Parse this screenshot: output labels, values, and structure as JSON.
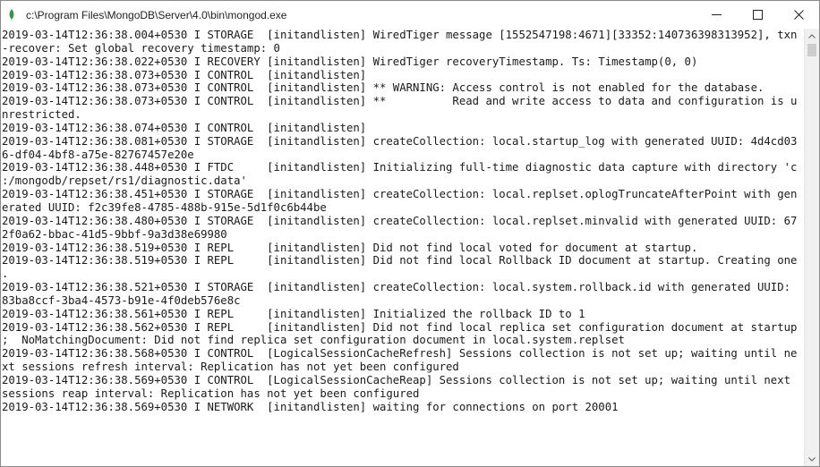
{
  "window": {
    "title": "c:\\Program Files\\MongoDB\\Server\\4.0\\bin\\mongod.exe",
    "accent_color": "#2e9e45",
    "icons": {
      "app": "mongodb-leaf-icon",
      "minimize": "minimize-icon",
      "maximize": "maximize-icon",
      "close": "close-icon",
      "scroll_up": "chevron-up-icon",
      "scroll_down": "chevron-down-icon"
    }
  },
  "console": {
    "lines": [
      "2019-03-14T12:36:38.004+0530 I STORAGE  [initandlisten] WiredTiger message [1552547198:4671][33352:140736398313952], txn",
      "-recover: Set global recovery timestamp: 0",
      "2019-03-14T12:36:38.022+0530 I RECOVERY [initandlisten] WiredTiger recoveryTimestamp. Ts: Timestamp(0, 0)",
      "2019-03-14T12:36:38.073+0530 I CONTROL  [initandlisten]",
      "2019-03-14T12:36:38.073+0530 I CONTROL  [initandlisten] ** WARNING: Access control is not enabled for the database.",
      "2019-03-14T12:36:38.073+0530 I CONTROL  [initandlisten] **          Read and write access to data and configuration is u",
      "nrestricted.",
      "2019-03-14T12:36:38.074+0530 I CONTROL  [initandlisten]",
      "2019-03-14T12:36:38.081+0530 I STORAGE  [initandlisten] createCollection: local.startup_log with generated UUID: 4d4cd03",
      "6-df04-4bf8-a75e-82767457e20e",
      "2019-03-14T12:36:38.448+0530 I FTDC     [initandlisten] Initializing full-time diagnostic data capture with directory 'c",
      ":/mongodb/repset/rs1/diagnostic.data'",
      "2019-03-14T12:36:38.451+0530 I STORAGE  [initandlisten] createCollection: local.replset.oplogTruncateAfterPoint with gen",
      "erated UUID: f2c39fe8-4785-488b-915e-5d1f0c6b44be",
      "2019-03-14T12:36:38.480+0530 I STORAGE  [initandlisten] createCollection: local.replset.minvalid with generated UUID: 67",
      "2f0a62-bbac-41d5-9bbf-9a3d38e69980",
      "2019-03-14T12:36:38.519+0530 I REPL     [initandlisten] Did not find local voted for document at startup.",
      "2019-03-14T12:36:38.519+0530 I REPL     [initandlisten] Did not find local Rollback ID document at startup. Creating one",
      ".",
      "2019-03-14T12:36:38.521+0530 I STORAGE  [initandlisten] createCollection: local.system.rollback.id with generated UUID:",
      "83ba8ccf-3ba4-4573-b91e-4f0deb576e8c",
      "2019-03-14T12:36:38.561+0530 I REPL     [initandlisten] Initialized the rollback ID to 1",
      "2019-03-14T12:36:38.562+0530 I REPL     [initandlisten] Did not find local replica set configuration document at startup",
      ";  NoMatchingDocument: Did not find replica set configuration document in local.system.replset",
      "2019-03-14T12:36:38.568+0530 I CONTROL  [LogicalSessionCacheRefresh] Sessions collection is not set up; waiting until ne",
      "xt sessions refresh interval: Replication has not yet been configured",
      "2019-03-14T12:36:38.569+0530 I CONTROL  [LogicalSessionCacheReap] Sessions collection is not set up; waiting until next",
      "sessions reap interval: Replication has not yet been configured",
      "2019-03-14T12:36:38.569+0530 I NETWORK  [initandlisten] waiting for connections on port 20001"
    ]
  }
}
